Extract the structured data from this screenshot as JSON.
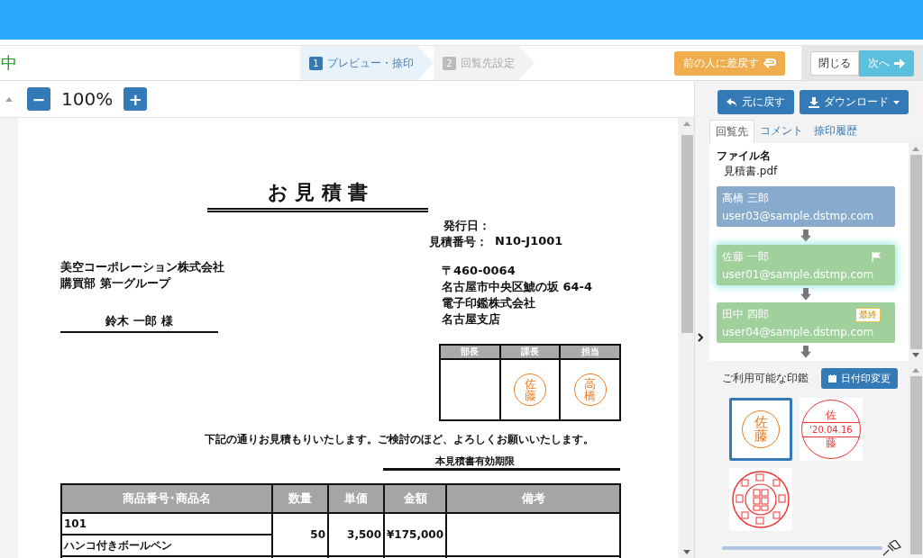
{
  "toolbar": {
    "title_fragment": "中",
    "steps": [
      {
        "number": "1",
        "label": "プレビュー・捺印",
        "selected": true
      },
      {
        "number": "2",
        "label": "回覧先設定",
        "selected": false
      }
    ],
    "return_button": "前の人に差戻す",
    "close_button": "閉じる",
    "next_button": "次へ"
  },
  "viewer": {
    "zoom": "100%",
    "zoom_out": "−",
    "zoom_in": "+"
  },
  "document": {
    "title": "お 見 積 書",
    "issue_date_label": "発行日：",
    "estimate_no_label": "見積番号：",
    "estimate_no": "N10-J1001",
    "customer": [
      "美空コーポレーション株式会社",
      "購買部 第一グループ"
    ],
    "addressee": "鈴木 一郎 様",
    "sender": [
      "〒460-0064",
      "名古屋市中央区鯱の坂 64-4",
      "電子印鑑株式会社",
      "名古屋支店"
    ],
    "approvals": [
      {
        "role": "部長"
      },
      {
        "role": "課長",
        "stamp": [
          "佐",
          "藤"
        ]
      },
      {
        "role": "担当",
        "stamp": [
          "高",
          "橋"
        ]
      }
    ],
    "message": "下記の通りお見積もりいたします。ご検討のほど、よろしくお願いいたします。",
    "validity_label": "本見積書有効期限",
    "columns": [
      "商品番号･商品名",
      "数量",
      "単価",
      "金額",
      "備考"
    ],
    "rows": [
      {
        "code": "101",
        "name": "ハンコ付きボールペン",
        "quantity": "50",
        "unit_price": "3,500",
        "amount": "¥175,000"
      }
    ]
  },
  "side": {
    "undo_button": "元に戻す",
    "download_button": "ダウンロード",
    "tabs": [
      {
        "label": "回覧先",
        "selected": true
      },
      {
        "label": "コメント",
        "selected": false
      },
      {
        "label": "捺印履歴",
        "selected": false
      }
    ],
    "file_label": "ファイル名",
    "file_name": "見積書.pdf",
    "recipients": [
      {
        "name": "高橋 三郎",
        "email": "user03@sample.dstmp.com",
        "completed": true,
        "current": false,
        "flagged": false
      },
      {
        "name": "佐藤 一郎",
        "email": "user01@sample.dstmp.com",
        "completed": false,
        "current": true,
        "flagged": true
      },
      {
        "name": "田中 四郎",
        "email": "user04@sample.dstmp.com",
        "completed": false,
        "current": false,
        "flagged": false,
        "badge": "最終"
      }
    ],
    "stamps_label": "ご利用可能な印鑑",
    "date_button": "日付印変更",
    "stamps": [
      {
        "kind": "name",
        "lines": [
          "佐",
          "藤"
        ],
        "selected": true
      },
      {
        "kind": "date",
        "lines": [
          "佐",
          "'20.04.16",
          "藤"
        ],
        "selected": false
      },
      {
        "kind": "seal",
        "selected": false
      }
    ],
    "size_slider": {
      "level": 1
    }
  }
}
